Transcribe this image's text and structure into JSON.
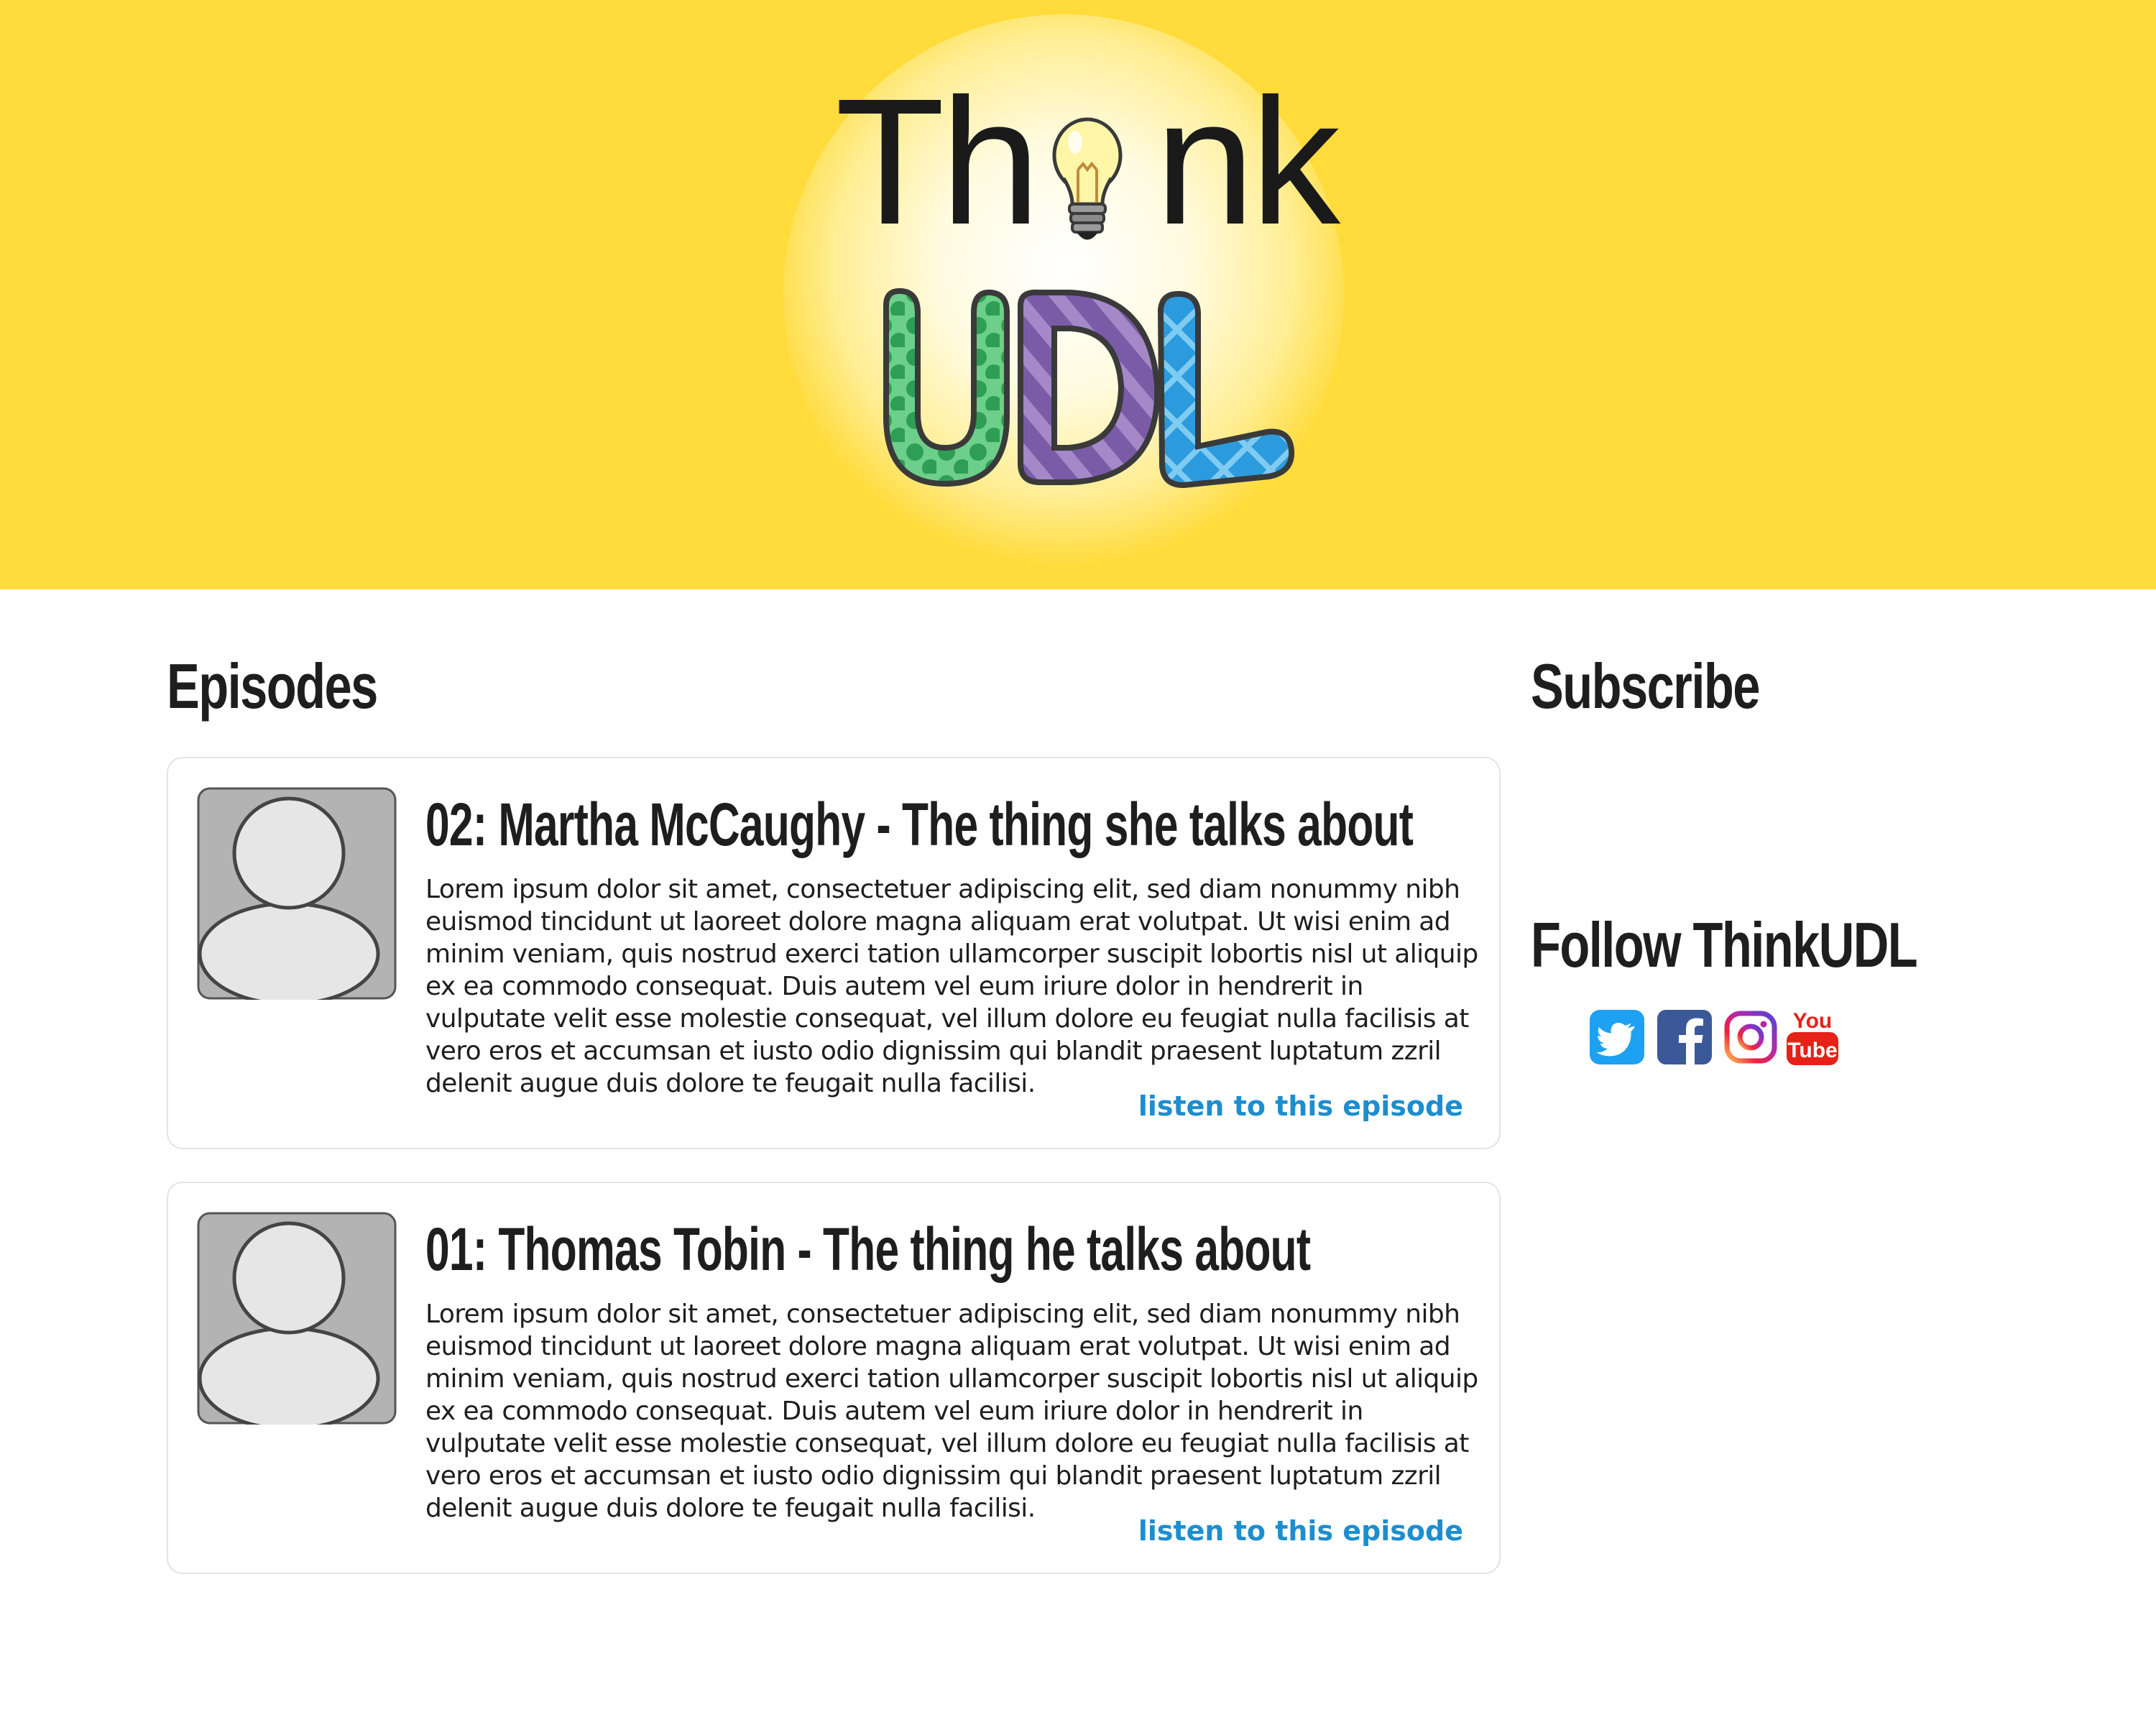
{
  "header": {
    "logo_text_parts": [
      "Th",
      "nk"
    ],
    "logo_udl": "UDL",
    "logo_name": "Think UDL"
  },
  "main": {
    "heading": "Episodes",
    "episodes": [
      {
        "title": "02: Martha McCaughy - The thing she talks about",
        "description": "Lorem ipsum dolor sit amet, consectetuer adipiscing elit, sed diam nonummy nibh euismod tincidunt ut laoreet dolore magna aliquam erat volutpat. Ut wisi enim ad minim veniam, quis nostrud exerci tation ullamcorper suscipit lobortis nisl ut aliquip ex ea commodo consequat. Duis autem vel eum iriure dolor in hendrerit in vulputate velit esse molestie consequat, vel illum dolore eu feugiat nulla facilisis at vero eros et accumsan et iusto odio dignissim qui blandit praesent luptatum zzril delenit augue duis dolore te feugait nulla facilisi.",
        "link_label": "listen to this episode"
      },
      {
        "title": "01: Thomas Tobin - The thing he talks about",
        "description": "Lorem ipsum dolor sit amet, consectetuer adipiscing elit, sed diam nonummy nibh euismod tincidunt ut laoreet dolore magna aliquam erat volutpat. Ut wisi enim ad minim veniam, quis nostrud exerci tation ullamcorper suscipit lobortis nisl ut aliquip ex ea commodo consequat. Duis autem vel eum iriure dolor in hendrerit in vulputate velit esse molestie consequat, vel illum dolore eu feugiat nulla facilisis at vero eros et accumsan et iusto odio dignissim qui blandit praesent luptatum zzril delenit augue duis dolore te feugait nulla facilisi.",
        "link_label": "listen to this episode"
      }
    ]
  },
  "sidebar": {
    "subscribe_heading": "Subscribe",
    "follow_heading": "Follow ThinkUDL",
    "social": [
      {
        "icon": "twitter-icon"
      },
      {
        "icon": "facebook-icon"
      },
      {
        "icon": "instagram-icon"
      },
      {
        "icon": "youtube-icon",
        "label_top": "You",
        "label_bottom": "Tube"
      }
    ]
  },
  "colors": {
    "banner": "#FFDB3B",
    "link": "#1c8ed0",
    "text": "#1e1e1e",
    "twitter": "#1DA1F2",
    "facebook": "#3B5998",
    "youtube": "#E62117"
  }
}
